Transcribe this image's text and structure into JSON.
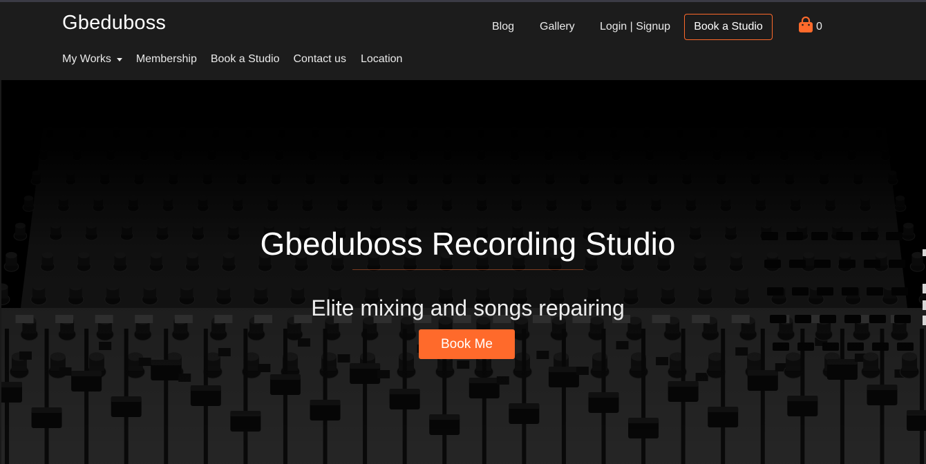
{
  "header": {
    "brand": "Gbeduboss",
    "top_nav": {
      "blog": "Blog",
      "gallery": "Gallery",
      "login": "Login | Signup",
      "book_button": "Book a Studio"
    },
    "cart": {
      "icon": "shopping-bag-icon",
      "count": "0",
      "accent": "#ff6a2b"
    },
    "bottom_nav": {
      "my_works": "My Works",
      "membership": "Membership",
      "book_studio": "Book a Studio",
      "contact": "Contact us",
      "location": "Location"
    }
  },
  "hero": {
    "title": "Gbeduboss Recording Studio",
    "subtitle": "Elite mixing and songs repairing",
    "cta": "Book Me",
    "cta_color": "#ff6a2b",
    "background_image": "mixing-console-photo"
  }
}
